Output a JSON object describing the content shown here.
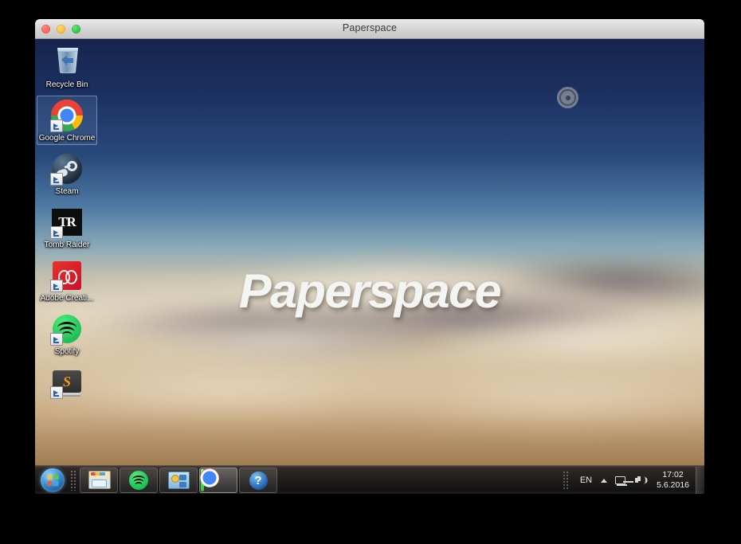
{
  "window": {
    "title": "Paperspace",
    "controls": [
      {
        "name": "close",
        "color": "#ff5f57"
      },
      {
        "name": "minimize",
        "color": "#ffbd2e"
      },
      {
        "name": "zoom",
        "color": "#28c840"
      }
    ]
  },
  "desktop": {
    "wallpaper_wordmark": "Paperspace",
    "recording_indicator": "record-target-icon",
    "icons": [
      {
        "label": "Recycle Bin",
        "art": "recyclebin",
        "shortcut": false,
        "selected": false
      },
      {
        "label": "Google Chrome",
        "art": "chrome",
        "shortcut": true,
        "selected": true
      },
      {
        "label": "Steam",
        "art": "steam",
        "shortcut": true,
        "selected": false
      },
      {
        "label": "Tomb Raider",
        "art": "tr",
        "shortcut": true,
        "selected": false
      },
      {
        "label": "Adobe Creati...",
        "art": "adobe",
        "shortcut": true,
        "selected": false
      },
      {
        "label": "Spotify",
        "art": "spotify",
        "shortcut": true,
        "selected": false
      },
      {
        "label": "",
        "art": "sublime",
        "shortcut": true,
        "selected": false
      }
    ]
  },
  "taskbar": {
    "start_label": "Start",
    "items": [
      {
        "name": "windows-explorer",
        "art": "explorer",
        "active": false
      },
      {
        "name": "spotify",
        "art": "spotify",
        "active": false
      },
      {
        "name": "control-panel",
        "art": "cpanel",
        "active": false
      },
      {
        "name": "google-chrome",
        "art": "chrome",
        "active": true
      },
      {
        "name": "help",
        "art": "help",
        "active": false,
        "glyph": "?"
      }
    ],
    "tray": {
      "language": "EN",
      "show_hidden_icons": "chevron-up-icon",
      "network": "network-icon",
      "volume": "speaker-icon",
      "time": "17:02",
      "date": "5.6.2016"
    },
    "show_desktop_label": "Show desktop"
  }
}
